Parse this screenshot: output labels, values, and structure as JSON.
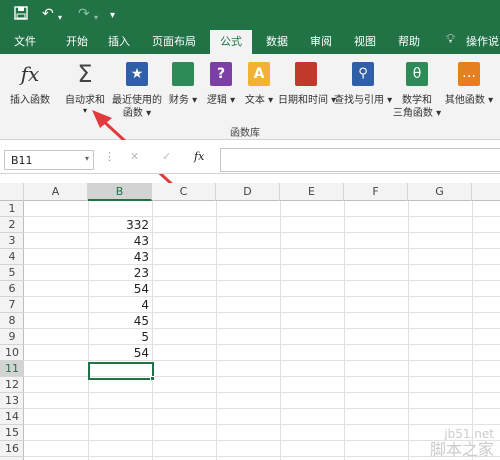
{
  "qat": {
    "save_icon": "save-icon",
    "undo_icon": "undo-icon",
    "redo_icon": "redo-icon"
  },
  "menu": [
    "文件",
    "开始",
    "插入",
    "页面布局",
    "公式",
    "数据",
    "审阅",
    "视图",
    "帮助"
  ],
  "tell_me": "操作说",
  "ribbon": {
    "buttons": [
      {
        "label": "插入函数",
        "icon": "fx-icon"
      },
      {
        "label": "自动求和",
        "icon": "sigma-icon"
      },
      {
        "label": "最近使用的",
        "sub": "函数",
        "icon": "star-icon",
        "color": "#2f5fa6"
      },
      {
        "label": "财务",
        "icon": "book-icon",
        "color": "#2e8b57"
      },
      {
        "label": "逻辑",
        "icon": "question-icon",
        "color": "#7b3fa6"
      },
      {
        "label": "文本",
        "icon": "letter-a-icon",
        "color": "#d68a00"
      },
      {
        "label": "日期和时间",
        "icon": "calendar-icon",
        "color": "#c0392b"
      },
      {
        "label": "查找与引用",
        "icon": "search-icon",
        "color": "#2f5fa6"
      },
      {
        "label": "数学和",
        "sub": "三角函数",
        "icon": "theta-icon",
        "color": "#2e8b57"
      },
      {
        "label": "其他函数",
        "icon": "dots-icon",
        "color": "#d35400"
      }
    ],
    "group": "函数库"
  },
  "formula_bar": {
    "namebox": "B11",
    "fx": "fx"
  },
  "columns": [
    "A",
    "B",
    "C",
    "D",
    "E",
    "F",
    "G"
  ],
  "rows": [
    "1",
    "2",
    "3",
    "4",
    "5",
    "6",
    "7",
    "8",
    "9",
    "10",
    "11",
    "12",
    "13",
    "14",
    "15",
    "16"
  ],
  "cells_b": [
    "",
    "332",
    "43",
    "43",
    "23",
    "54",
    "4",
    "45",
    "5",
    "54",
    "",
    "",
    "",
    "",
    "",
    ""
  ],
  "watermark": {
    "line1": "jb51.net",
    "line2": "脚本之家"
  }
}
